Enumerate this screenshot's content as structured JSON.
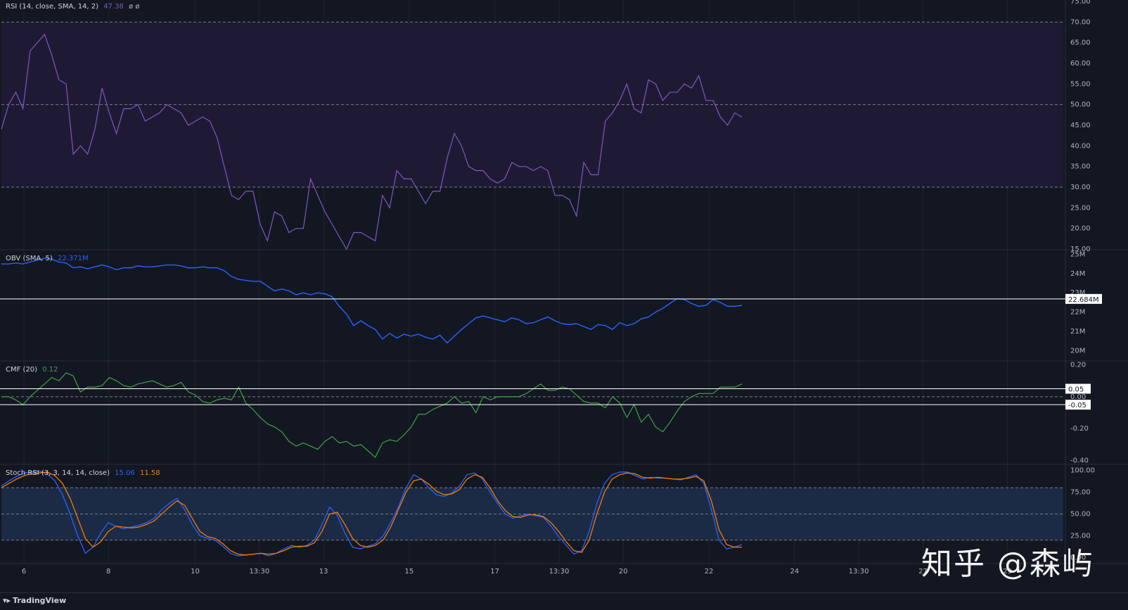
{
  "colors": {
    "background": "#131722",
    "grid": "#1f2433",
    "rsi_line": "#7e57c2",
    "rsi_band": "#1f1a33",
    "obv_line": "#2962ff",
    "cmf_line": "#43a047",
    "stoch_k": "#2962ff",
    "stoch_d": "#f57c00",
    "stoch_band": "#1b2a45",
    "text": "#b2b5be",
    "white": "#ffffff"
  },
  "x_axis": {
    "ticks": [
      {
        "label": "6",
        "x": 0.02
      },
      {
        "label": "8",
        "x": 0.095
      },
      {
        "label": "10",
        "x": 0.172
      },
      {
        "label": "13:30",
        "x": 0.229
      },
      {
        "label": "13",
        "x": 0.286
      },
      {
        "label": "15",
        "x": 0.362
      },
      {
        "label": "17",
        "x": 0.438
      },
      {
        "label": "13:30",
        "x": 0.495
      },
      {
        "label": "20",
        "x": 0.552
      },
      {
        "label": "22",
        "x": 0.628
      },
      {
        "label": "24",
        "x": 0.704
      },
      {
        "label": "13:30",
        "x": 0.761
      },
      {
        "label": "27",
        "x": 0.818
      },
      {
        "label": "29",
        "x": 0.893
      }
    ]
  },
  "panes": {
    "rsi": {
      "legend_name": "RSI (14, close, SMA, 14, 2)",
      "legend_value": "47.38",
      "legend_extra": "ø  ø",
      "ylim": [
        15,
        75
      ],
      "ticks": [
        "75.00",
        "70.00",
        "65.00",
        "60.00",
        "55.00",
        "50.00",
        "45.00",
        "40.00",
        "35.00",
        "30.00",
        "25.00",
        "20.00",
        "15.00"
      ]
    },
    "obv": {
      "legend_name": "OBV (SMA, 5)",
      "legend_value": "22.371M",
      "ylim": [
        19.5,
        25.2
      ],
      "ticks": [
        "25M",
        "24M",
        "23M",
        "22M",
        "21M",
        "20M"
      ],
      "marker_label": "22.684M"
    },
    "cmf": {
      "legend_name": "CMF (20)",
      "legend_value": "0.12",
      "ylim": [
        -0.42,
        0.22
      ],
      "ticks": [
        "0.20",
        "0.00",
        "-0.20",
        "-0.40"
      ],
      "marker_labels": [
        "0.05",
        "-0.05"
      ]
    },
    "stoch": {
      "legend_name": "Stoch RSI (3, 3, 14, 14, close)",
      "legend_k": "15.06",
      "legend_d": "11.58",
      "ylim": [
        0,
        100
      ],
      "ticks": [
        "100.00",
        "75.00",
        "50.00",
        "25.00",
        "0.00"
      ]
    }
  },
  "chart_data": [
    {
      "type": "line",
      "title": "RSI (14, close, SMA, 14, 2)",
      "ylim": [
        15,
        75
      ],
      "bands": [
        30,
        50,
        70
      ],
      "x": [
        0,
        1,
        2,
        3,
        4,
        5,
        6,
        7,
        8,
        9,
        10,
        11,
        12,
        13,
        14,
        15,
        16,
        17,
        18,
        19,
        20,
        21,
        22,
        23,
        24,
        25,
        26,
        27,
        28,
        29,
        30,
        31,
        32,
        33,
        34,
        35,
        36,
        37,
        38,
        39,
        40,
        41,
        42,
        43,
        44,
        45,
        46,
        47,
        48,
        49,
        50,
        51,
        52,
        53,
        54,
        55,
        56,
        57,
        58,
        59,
        60,
        61,
        62,
        63,
        64,
        65,
        66,
        67,
        68,
        69,
        70,
        71,
        72,
        73,
        74,
        75,
        76,
        77,
        78,
        79,
        80,
        81,
        82,
        83,
        84,
        85,
        86,
        87,
        88,
        89,
        90,
        91,
        92,
        93,
        94,
        95,
        96,
        97,
        98,
        99,
        100,
        101,
        102,
        103
      ],
      "series": [
        {
          "values": [
            44,
            50,
            53,
            49,
            63,
            65,
            67,
            62,
            56,
            55,
            38,
            40,
            38,
            44,
            54,
            48,
            43,
            49,
            49,
            50,
            46,
            47,
            48,
            50,
            49,
            48,
            45,
            46,
            47,
            46,
            42,
            35,
            28,
            27,
            29,
            29,
            21,
            17,
            24,
            23,
            19,
            20,
            20,
            32,
            28,
            24,
            21,
            18,
            15,
            19,
            19,
            18,
            17,
            28,
            25,
            34,
            32,
            32,
            29,
            26,
            29,
            29,
            37,
            43,
            40,
            35,
            34,
            34,
            32,
            31,
            32,
            36,
            35,
            35,
            34,
            35,
            34,
            28,
            28,
            27,
            23,
            36,
            33,
            33,
            46,
            48,
            51,
            55,
            49,
            48,
            56,
            55,
            51,
            53,
            53,
            55,
            54,
            57,
            51,
            51,
            47,
            45,
            48,
            47
          ]
        }
      ]
    },
    {
      "type": "line",
      "title": "OBV (SMA, 5)",
      "ylim": [
        19.5,
        25.2
      ],
      "x": [
        0,
        1,
        2,
        3,
        4,
        5,
        6,
        7,
        8,
        9,
        10,
        11,
        12,
        13,
        14,
        15,
        16,
        17,
        18,
        19,
        20,
        21,
        22,
        23,
        24,
        25,
        26,
        27,
        28,
        29,
        30,
        31,
        32,
        33,
        34,
        35,
        36,
        37,
        38,
        39,
        40,
        41,
        42,
        43,
        44,
        45,
        46,
        47,
        48,
        49,
        50,
        51,
        52,
        53,
        54,
        55,
        56,
        57,
        58,
        59,
        60,
        61,
        62,
        63,
        64,
        65,
        66,
        67,
        68,
        69,
        70,
        71,
        72,
        73,
        74,
        75,
        76,
        77,
        78,
        79,
        80,
        81,
        82,
        83,
        84,
        85,
        86,
        87,
        88,
        89,
        90,
        91,
        92,
        93,
        94,
        95,
        96,
        97,
        98,
        99,
        100,
        101,
        102,
        103
      ],
      "series": [
        {
          "values": [
            24.5,
            24.5,
            24.55,
            24.5,
            24.6,
            24.7,
            24.8,
            24.75,
            24.6,
            24.55,
            24.3,
            24.35,
            24.25,
            24.35,
            24.45,
            24.35,
            24.2,
            24.3,
            24.3,
            24.4,
            24.35,
            24.35,
            24.4,
            24.45,
            24.45,
            24.4,
            24.3,
            24.3,
            24.35,
            24.3,
            24.3,
            24.15,
            23.85,
            23.7,
            23.65,
            23.6,
            23.6,
            23.35,
            23.1,
            23.2,
            23.1,
            22.9,
            23.0,
            22.9,
            23.0,
            22.95,
            22.8,
            22.3,
            21.9,
            21.3,
            21.55,
            21.3,
            21.1,
            20.6,
            20.9,
            20.65,
            20.85,
            20.75,
            20.85,
            20.7,
            20.6,
            20.8,
            20.4,
            20.75,
            21.1,
            21.4,
            21.7,
            21.8,
            21.7,
            21.6,
            21.5,
            21.7,
            21.6,
            21.4,
            21.45,
            21.6,
            21.75,
            21.55,
            21.4,
            21.35,
            21.4,
            21.25,
            21.1,
            21.35,
            21.3,
            21.1,
            21.45,
            21.3,
            21.4,
            21.65,
            21.75,
            22.0,
            22.2,
            22.45,
            22.7,
            22.65,
            22.45,
            22.3,
            22.35,
            22.65,
            22.5,
            22.3,
            22.3,
            22.35
          ]
        }
      ]
    },
    {
      "type": "line",
      "title": "CMF (20)",
      "ylim": [
        -0.42,
        0.22
      ],
      "levels": [
        0.05,
        0.0,
        -0.05
      ],
      "x": [
        0,
        1,
        2,
        3,
        4,
        5,
        6,
        7,
        8,
        9,
        10,
        11,
        12,
        13,
        14,
        15,
        16,
        17,
        18,
        19,
        20,
        21,
        22,
        23,
        24,
        25,
        26,
        27,
        28,
        29,
        30,
        31,
        32,
        33,
        34,
        35,
        36,
        37,
        38,
        39,
        40,
        41,
        42,
        43,
        44,
        45,
        46,
        47,
        48,
        49,
        50,
        51,
        52,
        53,
        54,
        55,
        56,
        57,
        58,
        59,
        60,
        61,
        62,
        63,
        64,
        65,
        66,
        67,
        68,
        69,
        70,
        71,
        72,
        73,
        74,
        75,
        76,
        77,
        78,
        79,
        80,
        81,
        82,
        83,
        84,
        85,
        86,
        87,
        88,
        89,
        90,
        91,
        92,
        93,
        94,
        95,
        96,
        97,
        98,
        99,
        100,
        101,
        102,
        103
      ],
      "series": [
        {
          "values": [
            0.0,
            0.0,
            -0.02,
            -0.05,
            0.0,
            0.04,
            0.08,
            0.12,
            0.1,
            0.15,
            0.13,
            0.03,
            0.06,
            0.06,
            0.07,
            0.12,
            0.1,
            0.07,
            0.06,
            0.08,
            0.09,
            0.1,
            0.08,
            0.06,
            0.07,
            0.09,
            0.03,
            0.01,
            -0.03,
            -0.04,
            -0.02,
            -0.01,
            -0.02,
            0.06,
            -0.04,
            -0.08,
            -0.13,
            -0.17,
            -0.19,
            -0.22,
            -0.28,
            -0.31,
            -0.29,
            -0.31,
            -0.33,
            -0.28,
            -0.25,
            -0.29,
            -0.28,
            -0.31,
            -0.3,
            -0.34,
            -0.38,
            -0.29,
            -0.27,
            -0.28,
            -0.24,
            -0.19,
            -0.11,
            -0.11,
            -0.08,
            -0.06,
            -0.04,
            0.0,
            -0.04,
            -0.03,
            -0.1,
            0.0,
            -0.02,
            0.0,
            0.0,
            0.0,
            0.0,
            0.02,
            0.05,
            0.08,
            0.04,
            0.04,
            0.06,
            0.05,
            0.01,
            -0.03,
            -0.04,
            -0.04,
            -0.07,
            0.0,
            -0.04,
            -0.13,
            -0.05,
            -0.16,
            -0.11,
            -0.19,
            -0.22,
            -0.16,
            -0.09,
            -0.03,
            0.0,
            0.02,
            0.02,
            0.02,
            0.06,
            0.06,
            0.06,
            0.08,
            0.09,
            0.1,
            0.11,
            0.08,
            0.12,
            0.1,
            0.1,
            0.16,
            0.08,
            0.12,
            0.12
          ]
        }
      ]
    },
    {
      "type": "line",
      "title": "Stoch RSI (3, 3, 14, 14, close)",
      "ylim": [
        0,
        100
      ],
      "bands": [
        20,
        50,
        80
      ],
      "x": [
        0,
        1,
        2,
        3,
        4,
        5,
        6,
        7,
        8,
        9,
        10,
        11,
        12,
        13,
        14,
        15,
        16,
        17,
        18,
        19,
        20,
        21,
        22,
        23,
        24,
        25,
        26,
        27,
        28,
        29,
        30,
        31,
        32,
        33,
        34,
        35,
        36,
        37,
        38,
        39,
        40,
        41,
        42,
        43,
        44,
        45,
        46,
        47,
        48,
        49,
        50,
        51,
        52,
        53,
        54,
        55,
        56,
        57,
        58,
        59,
        60,
        61,
        62,
        63,
        64,
        65,
        66,
        67,
        68,
        69,
        70,
        71,
        72,
        73,
        74,
        75,
        76,
        77,
        78,
        79,
        80,
        81,
        82,
        83,
        84,
        85,
        86,
        87,
        88,
        89,
        90,
        91,
        92,
        93,
        94,
        95,
        96,
        97,
        98,
        99,
        100,
        101,
        102,
        103
      ],
      "series": [
        {
          "name": "K",
          "values": [
            82,
            88,
            93,
            97,
            98,
            99,
            96,
            88,
            72,
            50,
            25,
            5,
            12,
            28,
            40,
            36,
            33,
            35,
            37,
            40,
            45,
            55,
            62,
            68,
            55,
            38,
            25,
            22,
            20,
            13,
            5,
            2,
            3,
            4,
            5,
            2,
            5,
            10,
            14,
            12,
            14,
            20,
            38,
            58,
            48,
            28,
            12,
            10,
            13,
            16,
            25,
            40,
            58,
            80,
            95,
            90,
            80,
            72,
            70,
            74,
            82,
            95,
            97,
            90,
            75,
            62,
            50,
            45,
            48,
            50,
            48,
            46,
            36,
            24,
            14,
            4,
            8,
            30,
            62,
            85,
            95,
            98,
            98,
            94,
            90,
            92,
            91,
            91,
            90,
            89,
            92,
            95,
            85,
            55,
            20,
            10,
            12,
            15
          ]
        },
        {
          "name": "D",
          "values": [
            80,
            85,
            90,
            94,
            96,
            97,
            98,
            94,
            85,
            68,
            45,
            22,
            12,
            18,
            30,
            36,
            35,
            34,
            35,
            38,
            42,
            50,
            58,
            65,
            60,
            45,
            30,
            24,
            22,
            16,
            8,
            4,
            3,
            4,
            5,
            4,
            5,
            8,
            12,
            13,
            13,
            17,
            30,
            50,
            52,
            38,
            22,
            14,
            12,
            14,
            20,
            35,
            55,
            75,
            88,
            90,
            84,
            76,
            72,
            73,
            78,
            90,
            95,
            92,
            80,
            65,
            54,
            47,
            46,
            49,
            49,
            47,
            40,
            30,
            18,
            8,
            6,
            20,
            50,
            75,
            90,
            95,
            97,
            96,
            92,
            91,
            92,
            91,
            90,
            90,
            91,
            93,
            88,
            65,
            32,
            15,
            12,
            12
          ]
        }
      ]
    }
  ]
}
